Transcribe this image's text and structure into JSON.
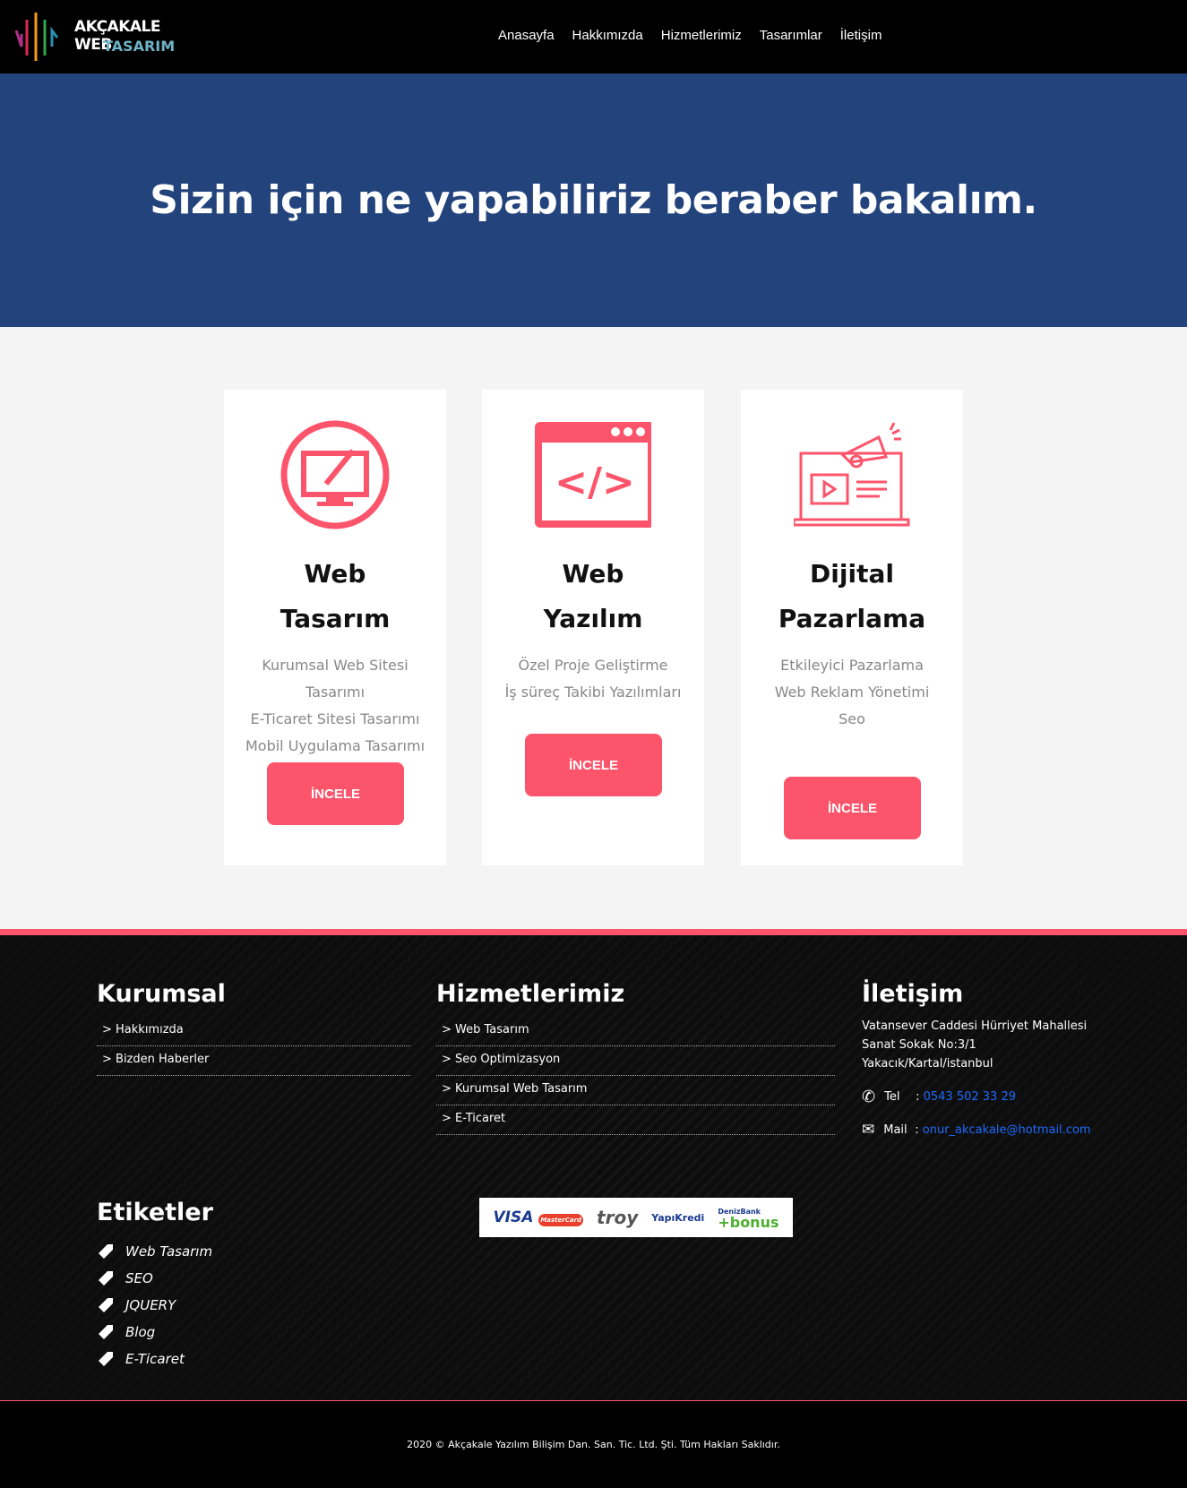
{
  "header": {
    "logo_line1": "AKÇAKALE WEB",
    "logo_line2": "TASARIM",
    "nav": [
      "Anasayfa",
      "Hakkımızda",
      "Hizmetlerimiz",
      "Tasarımlar",
      "İletişim"
    ]
  },
  "hero": {
    "title": "Sizin için ne yapabiliriz beraber bakalım."
  },
  "cards": [
    {
      "title": "Web Tasarım",
      "lines": [
        "Kurumsal Web Sitesi Tasarımı",
        "E-Ticaret Sitesi Tasarımı",
        "Mobil Uygulama Tasarımı"
      ],
      "button": "İNCELE",
      "icon": "monitor-brush-icon"
    },
    {
      "title": "Web Yazılım",
      "lines": [
        "Özel Proje Geliştirme",
        "İş süreç Takibi Yazılımları"
      ],
      "button": "İNCELE",
      "icon": "code-window-icon"
    },
    {
      "title": "Dijital Pazarlama",
      "lines": [
        "Etkileyici Pazarlama",
        "Web Reklam Yönetimi",
        "Seo"
      ],
      "button": "İNCELE",
      "icon": "megaphone-laptop-icon"
    }
  ],
  "footer": {
    "kurumsal": {
      "title": "Kurumsal",
      "items": [
        "> Hakkımızda",
        "> Bizden Haberler"
      ]
    },
    "hizmetler": {
      "title": "Hizmetlerimiz",
      "items": [
        "> Web Tasarım",
        "> Seo Optimizasyon",
        "> Kurumsal Web Tasarım",
        "> E-Ticaret"
      ]
    },
    "iletisim": {
      "title": "İletişim",
      "address": [
        "Vatansever Caddesi Hürriyet Mahallesi",
        "Sanat Sokak No:3/1",
        "Yakacık/Kartal/istanbul"
      ],
      "tel_label": "Tel",
      "tel": "0543 502 33 29",
      "mail_label": "Mail",
      "mail": "onur_akcakale@hotmail.com"
    },
    "etiketler": {
      "title": "Etiketler",
      "items": [
        "Web Tasarım",
        "SEO",
        "JQUERY",
        "Blog",
        "E-Ticaret"
      ]
    },
    "payment": {
      "visa": "VISA",
      "mastercard": "MasterCard",
      "troy": "troy",
      "yapikredi": "YapıKredi",
      "denizbank": "DenizBank",
      "bonus": "+bonus"
    },
    "copyright": "2020 © Akçakale Yazılım Bilişim Dan. San. Tic. Ltd. Şti. Tüm Hakları Saklıdır."
  },
  "colors": {
    "accent": "#fc556b",
    "hero": "#23437c",
    "link": "#1e6bff"
  }
}
